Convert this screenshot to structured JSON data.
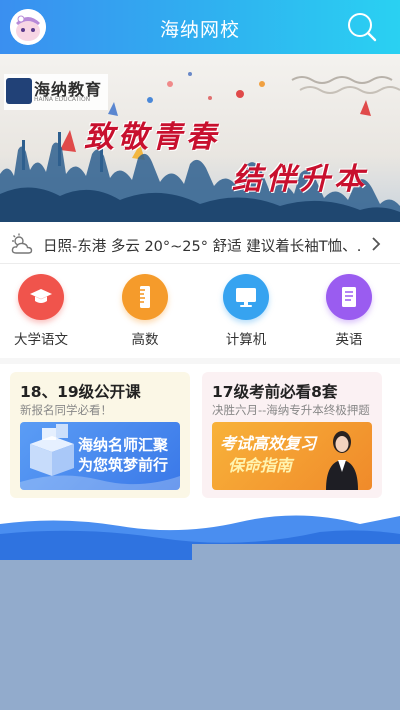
{
  "header": {
    "title": "海纳网校",
    "avatar_icon": "avatar-icon",
    "search_icon": "search-icon"
  },
  "banner": {
    "logo_text": "海纳教育",
    "logo_sub": "HAINA EDUCATION",
    "slogan_line1": "致敬青春",
    "slogan_line2": "结伴升本"
  },
  "weather": {
    "icon": "cloud-sun-icon",
    "text": "日照-东港 多云 20°~25° 舒适 建议着长袖T恤、…"
  },
  "categories": [
    {
      "label": "大学语文",
      "icon": "graduation-cap-icon",
      "color": "#f0544c"
    },
    {
      "label": "高数",
      "icon": "ruler-icon",
      "color": "#f59b2b"
    },
    {
      "label": "计算机",
      "icon": "monitor-icon",
      "color": "#36a3f0"
    },
    {
      "label": "英语",
      "icon": "book-icon",
      "color": "#9a5cf0"
    }
  ],
  "cards": [
    {
      "title": "18、19级公开课",
      "subtitle": "新报名同学必看！",
      "promo_line1": "海纳名师汇聚",
      "promo_line2": "为您筑梦前行"
    },
    {
      "title": "17级考前必看8套",
      "subtitle": "决胜六月--海纳专升本终极押题",
      "promo_line1": "考试高效复习",
      "promo_line2": "保命指南"
    }
  ],
  "colors": {
    "header_start": "#3a8ff0",
    "header_end": "#2ad1f2",
    "overlay": "#92abcc",
    "slogan": "#c8102e"
  }
}
